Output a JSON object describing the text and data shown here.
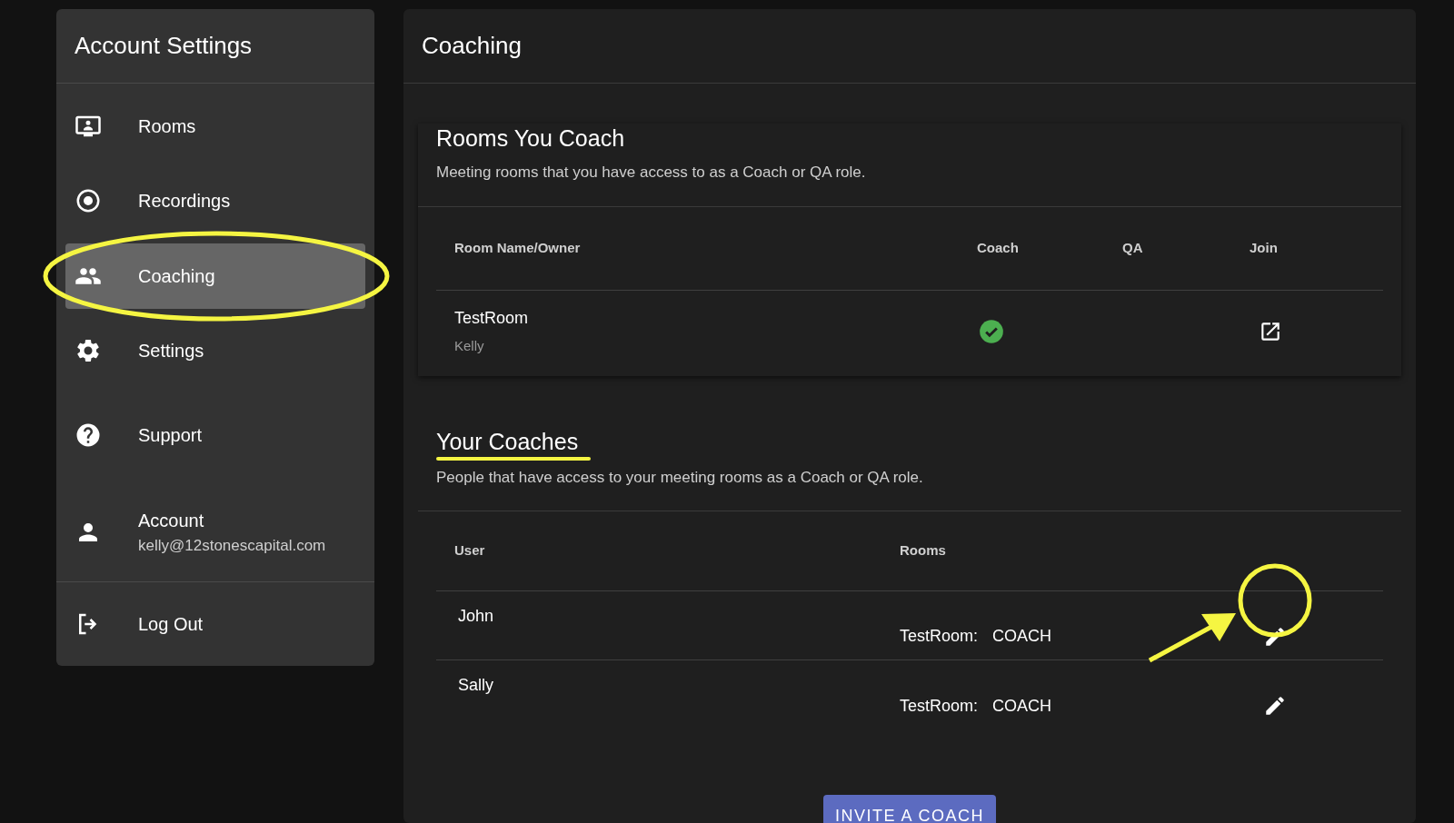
{
  "sidebar": {
    "title": "Account Settings",
    "items": [
      {
        "kind": "rooms",
        "label": "Rooms",
        "selected": false
      },
      {
        "kind": "recordings",
        "label": "Recordings",
        "selected": false
      },
      {
        "kind": "coaching",
        "label": "Coaching",
        "selected": true
      },
      {
        "kind": "settings",
        "label": "Settings",
        "selected": false
      },
      {
        "kind": "support",
        "label": "Support",
        "selected": false
      },
      {
        "kind": "account",
        "label": "Account",
        "sublabel": "kelly@12stonescapital.com",
        "selected": false
      }
    ],
    "logout": {
      "label": "Log Out"
    }
  },
  "main": {
    "title": "Coaching",
    "rooms_section": {
      "title": "Rooms You Coach",
      "subtitle": "Meeting rooms that you have access to as a Coach or QA role.",
      "columns": [
        "Room Name/Owner",
        "Coach",
        "QA",
        "Join"
      ],
      "rows": [
        {
          "room": "TestRoom",
          "owner": "Kelly",
          "coach": true
        }
      ]
    },
    "coaches_section": {
      "title": "Your Coaches",
      "subtitle": "People that have access to your meeting rooms as a Coach or QA role.",
      "columns": [
        "User",
        "Rooms"
      ],
      "rows": [
        {
          "user": "John",
          "room": "TestRoom:",
          "role": "COACH"
        },
        {
          "user": "Sally",
          "room": "TestRoom:",
          "role": "COACH"
        }
      ]
    },
    "invite_button": "INVITE A COACH"
  }
}
